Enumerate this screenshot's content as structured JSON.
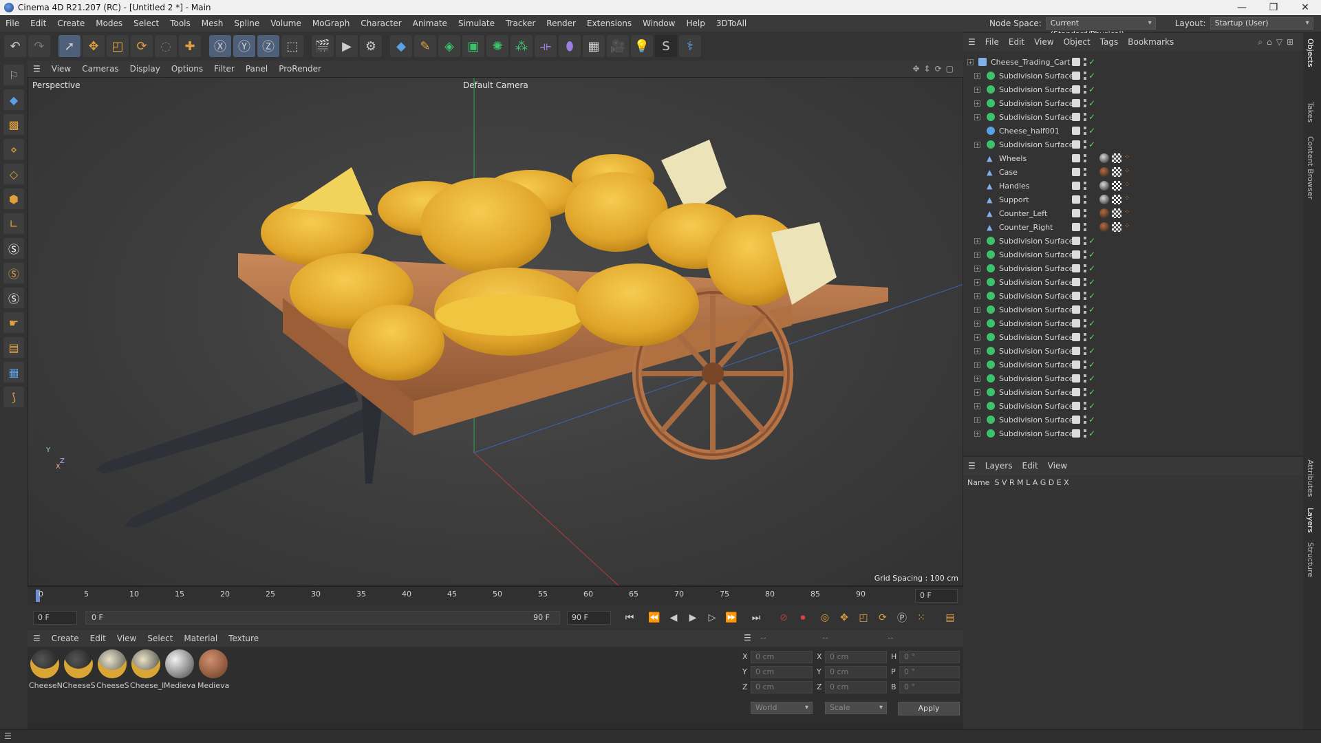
{
  "window": {
    "title": "Cinema 4D R21.207 (RC) - [Untitled 2 *] - Main",
    "controls": [
      "—",
      "❐",
      "✕"
    ]
  },
  "menubar": {
    "items": [
      "File",
      "Edit",
      "Create",
      "Modes",
      "Select",
      "Tools",
      "Mesh",
      "Spline",
      "Volume",
      "MoGraph",
      "Character",
      "Animate",
      "Simulate",
      "Tracker",
      "Render",
      "Extensions",
      "Window",
      "Help",
      "3DToAll"
    ],
    "node_space_label": "Node Space:",
    "node_space_value": "Current (Standard/Physical)",
    "layout_label": "Layout:",
    "layout_value": "Startup (User)"
  },
  "viewport": {
    "menu": [
      "View",
      "Cameras",
      "Display",
      "Options",
      "Filter",
      "Panel",
      "ProRender"
    ],
    "label": "Perspective",
    "camera": "Default Camera",
    "grid_spacing": "Grid Spacing : 100 cm",
    "axis_y": "Y",
    "axis_z": "Z",
    "axis_x": "X"
  },
  "timeline": {
    "ticks": [
      "0",
      "5",
      "10",
      "15",
      "20",
      "25",
      "30",
      "35",
      "40",
      "45",
      "50",
      "55",
      "60",
      "65",
      "70",
      "75",
      "80",
      "85",
      "90"
    ],
    "end_field": "0 F",
    "start_field": "0 F",
    "current_field": "0 F",
    "range_end": "90 F",
    "max_field": "90 F"
  },
  "materials": {
    "menu": [
      "Create",
      "Edit",
      "View",
      "Select",
      "Material",
      "Texture"
    ],
    "items": [
      {
        "name": "CheeseN",
        "color": "#1c1a14"
      },
      {
        "name": "CheeseS",
        "color": "#201c12"
      },
      {
        "name": "CheeseS",
        "color": "#2a2418"
      },
      {
        "name": "Cheese_l",
        "color": "#221d12"
      },
      {
        "name": "Medieva",
        "color": "#8c8c8c"
      },
      {
        "name": "Medieva",
        "color": "#9a5a3a"
      }
    ]
  },
  "coords": {
    "header_a": "--",
    "header_b": "--",
    "header_c": "--",
    "rows": [
      {
        "l1": "X",
        "v1": "0 cm",
        "l2": "X",
        "v2": "0 cm",
        "l3": "H",
        "v3": "0 °"
      },
      {
        "l1": "Y",
        "v1": "0 cm",
        "l2": "Y",
        "v2": "0 cm",
        "l3": "P",
        "v3": "0 °"
      },
      {
        "l1": "Z",
        "v1": "0 cm",
        "l2": "Z",
        "v2": "0 cm",
        "l3": "B",
        "v3": "0 °"
      }
    ],
    "world": "World",
    "scale": "Scale",
    "apply": "Apply"
  },
  "object_manager": {
    "menu": [
      "File",
      "Edit",
      "View",
      "Object",
      "Tags",
      "Bookmarks"
    ],
    "objects": [
      {
        "name": "Cheese_Trading_Cart",
        "type": "null",
        "level": 0
      },
      {
        "name": "Subdivision Surface",
        "type": "subd",
        "level": 1
      },
      {
        "name": "Subdivision Surface",
        "type": "subd",
        "level": 1
      },
      {
        "name": "Subdivision Surface",
        "type": "subd",
        "level": 1
      },
      {
        "name": "Subdivision Surface",
        "type": "subd",
        "level": 1
      },
      {
        "name": "Cheese_half001",
        "type": "poly",
        "level": 1
      },
      {
        "name": "Subdivision Surface",
        "type": "subd",
        "level": 1
      },
      {
        "name": "Wheels",
        "type": "mesh",
        "level": 1,
        "tag": "#d8d8d8"
      },
      {
        "name": "Case",
        "type": "mesh",
        "level": 1,
        "tag": "#b86a3a"
      },
      {
        "name": "Handles",
        "type": "mesh",
        "level": 1,
        "tag": "#d8d8d8"
      },
      {
        "name": "Support",
        "type": "mesh",
        "level": 1,
        "tag": "#d8d8d8"
      },
      {
        "name": "Counter_Left",
        "type": "mesh",
        "level": 1,
        "tag": "#b86a3a"
      },
      {
        "name": "Counter_Right",
        "type": "mesh",
        "level": 1,
        "tag": "#b86a3a"
      },
      {
        "name": "Subdivision Surface",
        "type": "subd",
        "level": 1
      },
      {
        "name": "Subdivision Surface",
        "type": "subd",
        "level": 1
      },
      {
        "name": "Subdivision Surface",
        "type": "subd",
        "level": 1
      },
      {
        "name": "Subdivision Surface",
        "type": "subd",
        "level": 1
      },
      {
        "name": "Subdivision Surface",
        "type": "subd",
        "level": 1
      },
      {
        "name": "Subdivision Surface",
        "type": "subd",
        "level": 1
      },
      {
        "name": "Subdivision Surface",
        "type": "subd",
        "level": 1
      },
      {
        "name": "Subdivision Surface",
        "type": "subd",
        "level": 1
      },
      {
        "name": "Subdivision Surface",
        "type": "subd",
        "level": 1
      },
      {
        "name": "Subdivision Surface",
        "type": "subd",
        "level": 1
      },
      {
        "name": "Subdivision Surface",
        "type": "subd",
        "level": 1
      },
      {
        "name": "Subdivision Surface",
        "type": "subd",
        "level": 1
      },
      {
        "name": "Subdivision Surface",
        "type": "subd",
        "level": 1
      },
      {
        "name": "Subdivision Surface",
        "type": "subd",
        "level": 1
      },
      {
        "name": "Subdivision Surface",
        "type": "subd",
        "level": 1
      }
    ]
  },
  "layers": {
    "menu": [
      "Layers",
      "Edit",
      "View"
    ],
    "columns": "Name  S V R M L A G D E X"
  },
  "right_tabs": [
    "Objects",
    "Takes",
    "Content Browser",
    "Attributes",
    "Layers",
    "Structure"
  ],
  "colors": {
    "accent": "#4e7fc9",
    "subd_icon": "#3ac36a",
    "check": "#5fd35f"
  }
}
